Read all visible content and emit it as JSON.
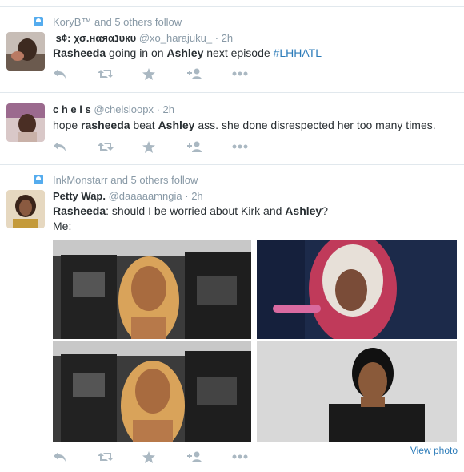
{
  "tweets": [
    {
      "context": "KoryB™ and 5 others follow",
      "name": "​ s¢: χσ.нαяαנυкυ",
      "handle": "@xo_harajuku_",
      "time": "2h",
      "text_parts": [
        "Rasheeda",
        " going in on ",
        "Ashley",
        " next episode  ",
        "#LHHATL"
      ]
    },
    {
      "name": "c h e l s",
      "handle": "@chelsloopx",
      "time": "2h",
      "text_parts": [
        "hope ",
        "rasheeda",
        " beat ",
        "Ashley",
        " ass. she done disrespected her too many times."
      ]
    },
    {
      "context": "InkMonstarr and 5 others follow",
      "name": "Petty Wap.",
      "handle": "@daaaaamngia",
      "time": "2h",
      "line1_parts": [
        "Rasheeda",
        ": should I be worried about Kirk and ",
        "Ashley",
        "?"
      ],
      "line2": "Me:",
      "view_photo": "View photo"
    }
  ],
  "icons": [
    "reply-icon",
    "retweet-icon",
    "favorite-icon",
    "follow-icon",
    "more-icon"
  ],
  "colors": {
    "meta": "#8899a6",
    "link": "#2b7bb9",
    "badge": "#55acee",
    "icon": "#aab8c2",
    "divider": "#e1e8ed"
  }
}
